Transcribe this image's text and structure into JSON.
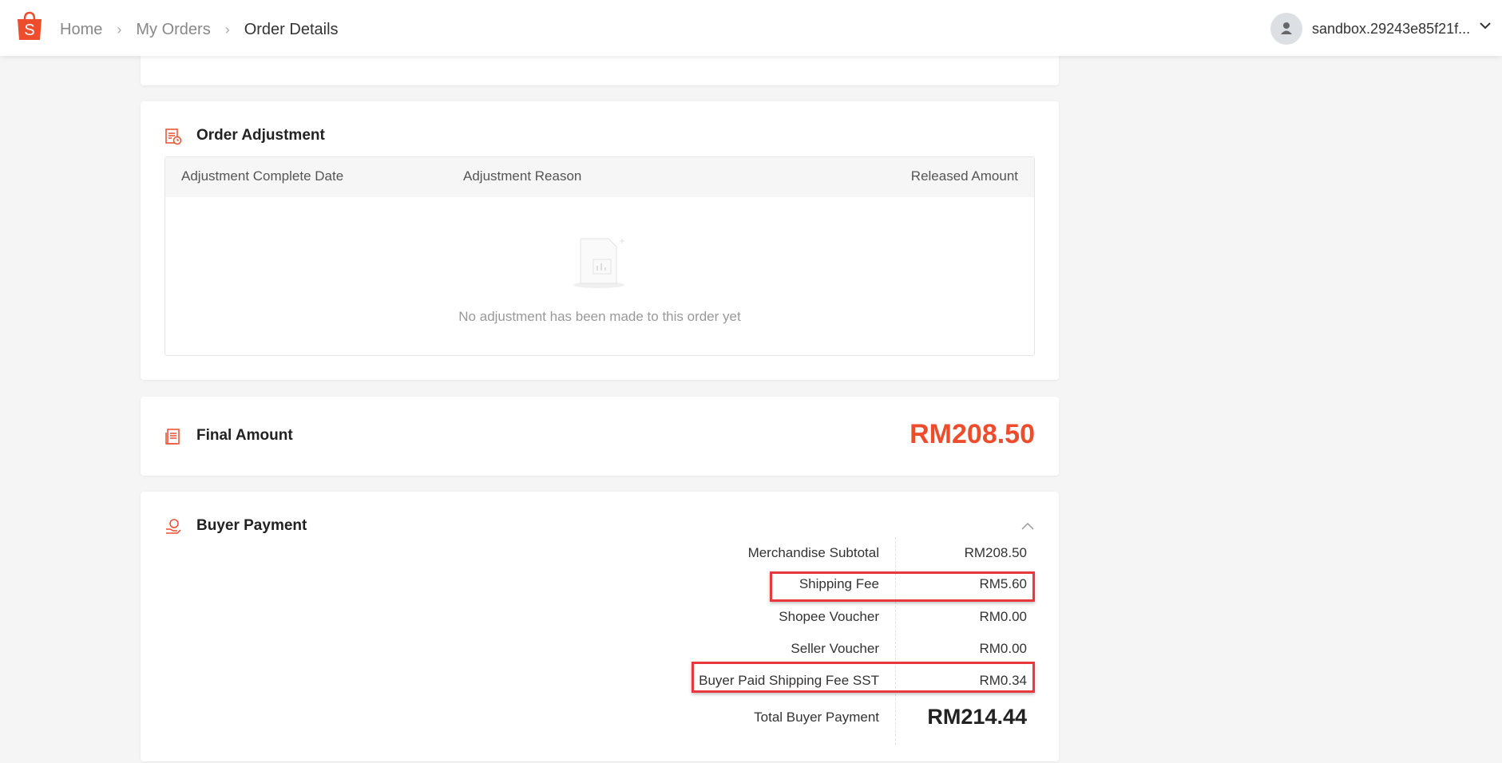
{
  "header": {
    "breadcrumb": [
      "Home",
      "My Orders",
      "Order Details"
    ],
    "username": "sandbox.29243e85f21f..."
  },
  "order_adjustment": {
    "title": "Order Adjustment",
    "columns": [
      "Adjustment Complete Date",
      "Adjustment Reason",
      "Released Amount"
    ],
    "empty_text": "No adjustment has been made to this order yet"
  },
  "final_amount": {
    "title": "Final Amount",
    "value": "RM208.50"
  },
  "buyer_payment": {
    "title": "Buyer Payment",
    "rows": [
      {
        "label": "Merchandise Subtotal",
        "value": "RM208.50"
      },
      {
        "label": "Shipping Fee",
        "value": "RM5.60"
      },
      {
        "label": "Shopee Voucher",
        "value": "RM0.00"
      },
      {
        "label": "Seller Voucher",
        "value": "RM0.00"
      },
      {
        "label": "Buyer Paid Shipping Fee SST",
        "value": "RM0.34"
      },
      {
        "label": "Total Buyer Payment",
        "value": "RM214.44"
      }
    ]
  },
  "colors": {
    "accent": "#ee4d2d",
    "highlight": "#e8373d"
  }
}
